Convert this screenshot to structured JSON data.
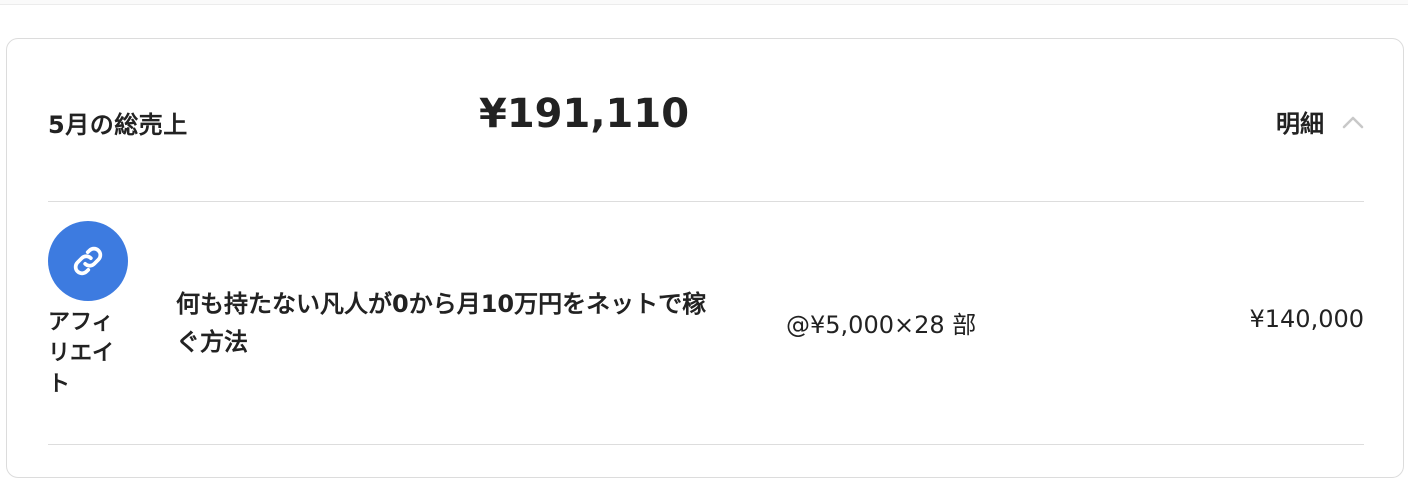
{
  "summary": {
    "label": "5月の総売上",
    "amount": "¥191,110",
    "detail_label": "明細",
    "detail_icon": "chevron-up-icon"
  },
  "items": [
    {
      "type_icon": "link-icon",
      "type_label": "アフィリエイト",
      "title": "何も持たない凡人が0から月10万円をネットで稼ぐ方法",
      "unit_price": "@¥5,000×28 部",
      "total": "¥140,000"
    }
  ],
  "colors": {
    "accent": "#3d7be0",
    "divider": "#dddddd",
    "text": "#222222"
  }
}
